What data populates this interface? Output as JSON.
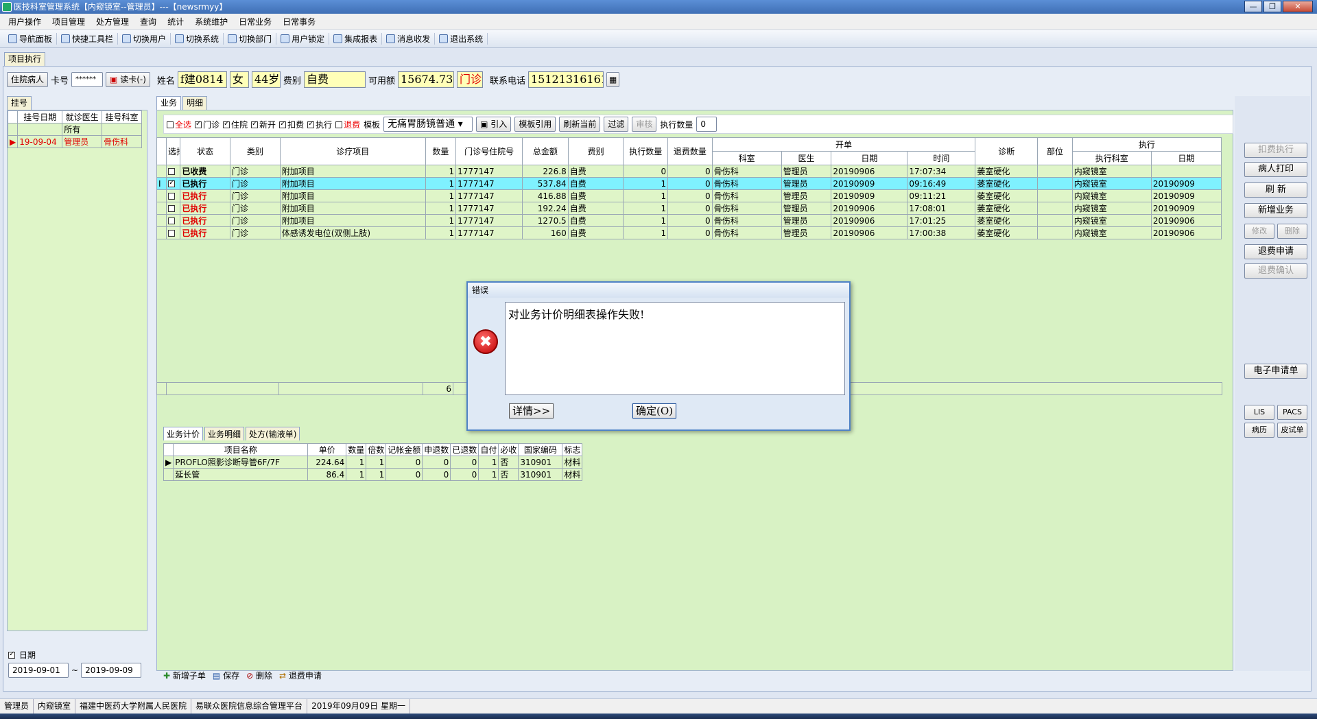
{
  "window": {
    "title": "医技科室管理系统【内窥镜室--管理员】---【newsrmyy】",
    "controls": [
      "—",
      "❐",
      "✕"
    ]
  },
  "menu": [
    "用户操作",
    "项目管理",
    "处方管理",
    "查询",
    "统计",
    "系统维护",
    "日常业务",
    "日常事务"
  ],
  "toolbar": [
    "导航面板",
    "快捷工具栏",
    "切换用户",
    "切换系统",
    "切换部门",
    "用户锁定",
    "集成报表",
    "消息收发",
    "退出系统"
  ],
  "doc_tab": "项目执行",
  "patient": {
    "type_btn": "住院病人",
    "card_label": "卡号",
    "card_value": "******",
    "read_card": "读卡(-)",
    "name_label": "姓名",
    "name": "f建0814",
    "sex": "女",
    "age": "44岁",
    "fee_label": "费别",
    "fee_type": "自费",
    "balance_label": "可用额",
    "balance": "15674.73",
    "visit_type": "门诊",
    "phone_label": "联系电话",
    "phone": "15121316161"
  },
  "left": {
    "tab": "挂号",
    "headers": [
      "挂号日期",
      "就诊医生",
      "挂号科室"
    ],
    "filter_row": [
      "",
      "所有",
      ""
    ],
    "rows": [
      [
        "19-09-04",
        "管理员",
        "骨伤科"
      ]
    ],
    "date_label": "日期",
    "date_from": "2019-09-01",
    "date_to": "2019-09-09",
    "tilde": "~"
  },
  "center": {
    "tabs": [
      "业务",
      "明细"
    ],
    "ops": {
      "select_all": "全选",
      "outpatient": "门诊",
      "inpatient": "住院",
      "new_open": "新开",
      "deduct": "扣费",
      "execute": "执行",
      "refund": "退费",
      "template_label": "模板",
      "template_value": "无痛胃肠镜普通",
      "import": "引入",
      "template_ref": "模板引用",
      "refresh_current": "刷新当前",
      "filter": "过滤",
      "audit": "审核",
      "exec_count_label": "执行数量",
      "exec_count": "0"
    },
    "header_groups": {
      "open": "开单",
      "exec": "执行"
    },
    "headers": [
      "选择",
      "状态",
      "类别",
      "诊疗项目",
      "数量",
      "门诊号住院号",
      "总金额",
      "费别",
      "执行数量",
      "退费数量",
      "科室",
      "医生",
      "日期",
      "时间",
      "诊断",
      "部位",
      "执行科室",
      "日期"
    ],
    "rows": [
      [
        "",
        "已收费",
        "门诊",
        "附加项目",
        "1",
        "1777147",
        "226.8",
        "自费",
        "0",
        "0",
        "骨伤科",
        "管理员",
        "20190906",
        "17:07:34",
        "萎室硬化",
        "",
        "内窥镜室",
        ""
      ],
      [
        "✓",
        "已执行",
        "门诊",
        "附加项目",
        "1",
        "1777147",
        "537.84",
        "自费",
        "1",
        "0",
        "骨伤科",
        "管理员",
        "20190909",
        "09:16:49",
        "萎室硬化",
        "",
        "内窥镜室",
        "20190909"
      ],
      [
        "",
        "已执行",
        "门诊",
        "附加项目",
        "1",
        "1777147",
        "416.88",
        "自费",
        "1",
        "0",
        "骨伤科",
        "管理员",
        "20190909",
        "09:11:21",
        "萎室硬化",
        "",
        "内窥镜室",
        "20190909"
      ],
      [
        "",
        "已执行",
        "门诊",
        "附加项目",
        "1",
        "1777147",
        "192.24",
        "自费",
        "1",
        "0",
        "骨伤科",
        "管理员",
        "20190906",
        "17:08:01",
        "萎室硬化",
        "",
        "内窥镜室",
        "20190909"
      ],
      [
        "",
        "已执行",
        "门诊",
        "附加项目",
        "1",
        "1777147",
        "1270.5",
        "自费",
        "1",
        "0",
        "骨伤科",
        "管理员",
        "20190906",
        "17:01:25",
        "萎室硬化",
        "",
        "内窥镜室",
        "20190906"
      ],
      [
        "",
        "已执行",
        "门诊",
        "体感诱发电位(双侧上肢)",
        "1",
        "1777147",
        "160",
        "自费",
        "1",
        "0",
        "骨伤科",
        "管理员",
        "20190906",
        "17:00:38",
        "萎室硬化",
        "",
        "内窥镜室",
        "20190906"
      ]
    ],
    "total_qty": "6",
    "bottom_tabs": [
      "业务计价",
      "业务明细",
      "处方(输液单)"
    ],
    "sub_headers": [
      "项目名称",
      "单价",
      "数量",
      "倍数",
      "记帐金额",
      "申退数",
      "已退数",
      "自付",
      "必收",
      "国家编码",
      "标志"
    ],
    "sub_rows": [
      [
        "PROFLO照影诊断导管6F/7F",
        "224.64",
        "1",
        "1",
        "0",
        "0",
        "0",
        "1",
        "否",
        "310901",
        "材料"
      ],
      [
        "延长管",
        "86.4",
        "1",
        "1",
        "0",
        "0",
        "0",
        "1",
        "否",
        "310901",
        "材料"
      ]
    ],
    "bottom_ops": [
      "新增子单",
      "保存",
      "删除",
      "退费申请"
    ]
  },
  "right_buttons": [
    "扣费执行",
    "病人打印",
    "刷 新",
    "新增业务",
    "修改",
    "删除",
    "退费申请",
    "退费确认",
    "电子申请单",
    "LIS",
    "PACS",
    "病历",
    "皮试单"
  ],
  "dialog": {
    "title": "错误",
    "message": "对业务计价明细表操作失败!",
    "details": "详情>>",
    "ok": "确定(O)"
  },
  "status": [
    "管理员",
    "内窥镜室",
    "福建中医药大学附属人民医院",
    "易联众医院信息综合管理平台",
    "2019年09月09日 星期一"
  ]
}
